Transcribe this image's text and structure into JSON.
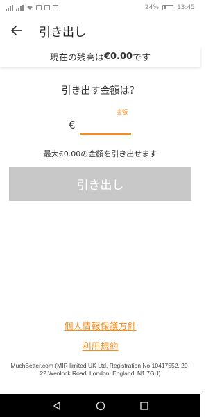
{
  "status_bar": {
    "battery": "24%",
    "time": "13:45"
  },
  "header": {
    "title": "引き出し",
    "back_icon": "arrow-left-icon"
  },
  "balance": {
    "label": "現在の残高は",
    "amount": "€0.00",
    "suffix": "です"
  },
  "form": {
    "question": "引き出す金額は？",
    "amount_label": "金額",
    "currency_symbol": "€",
    "amount_value": "",
    "max_note": "最大€0.00の金額を引き出せます",
    "submit_label": "引き出し"
  },
  "links": {
    "privacy": "個人情報保護方針",
    "terms": "利用規約"
  },
  "footer": {
    "legal": "MuchBetter.com (MIR limited UK Ltd, Registration No 10417552, 20-22 Wenlock Road, London, England, N1 7GU)"
  },
  "colors": {
    "accent": "#f28c1e",
    "button_disabled": "#c8c8c8",
    "nav_bar": "#000000"
  },
  "nav": {
    "back_icon": "triangle-back-icon",
    "home_icon": "circle-home-icon",
    "recents_icon": "square-recents-icon"
  }
}
